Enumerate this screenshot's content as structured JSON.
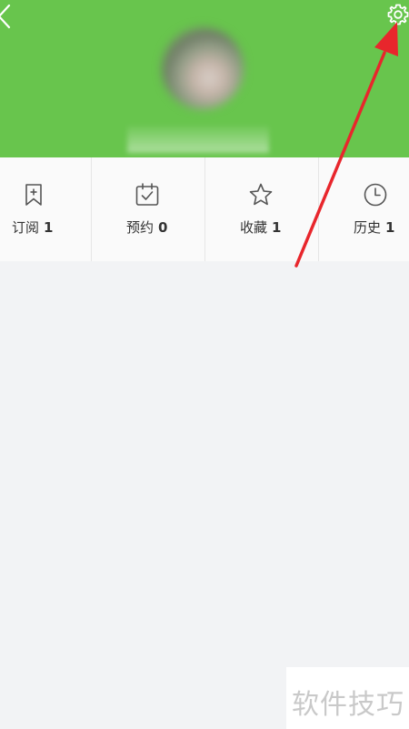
{
  "header": {
    "background_color": "#68c54d",
    "back_icon": "chevron-left-icon",
    "settings_icon": "gear-icon"
  },
  "tabs": [
    {
      "label": "订阅",
      "count": "1",
      "icon": "bookmark-plus-icon"
    },
    {
      "label": "预约",
      "count": "0",
      "icon": "calendar-check-icon"
    },
    {
      "label": "收藏",
      "count": "1",
      "icon": "star-icon"
    },
    {
      "label": "历史",
      "count": "1",
      "icon": "clock-icon"
    }
  ],
  "annotation": {
    "color": "#e8262c"
  },
  "watermark": {
    "text": "软件技巧"
  }
}
